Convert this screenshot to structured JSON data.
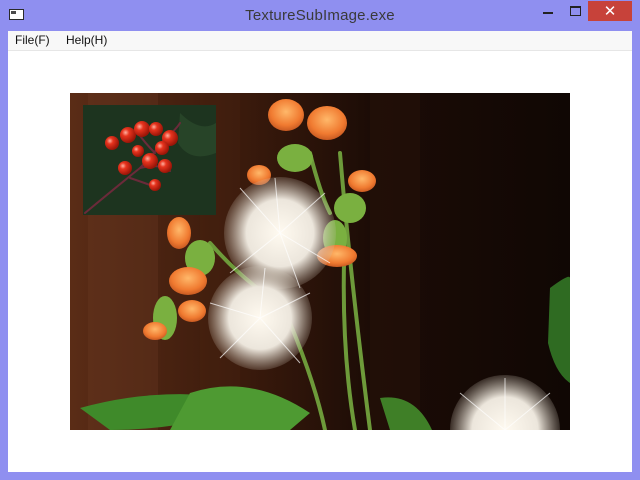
{
  "window": {
    "title": "TextureSubImage.exe",
    "icons": {
      "app": "window-app-icon",
      "minimize": "minimize-icon",
      "maximize": "maximize-icon",
      "close": "close-icon"
    },
    "close_symbol": "✕"
  },
  "menu": {
    "items": [
      {
        "label": "File(F)"
      },
      {
        "label": "Help(H)"
      }
    ]
  },
  "canvas": {
    "main_texture": "dandelion-flowers-photo",
    "sub_texture": "red-berries-photo"
  },
  "colors": {
    "frame": "#8f8ff0",
    "close_button": "#c7423a",
    "client_background": "#ffffff"
  }
}
